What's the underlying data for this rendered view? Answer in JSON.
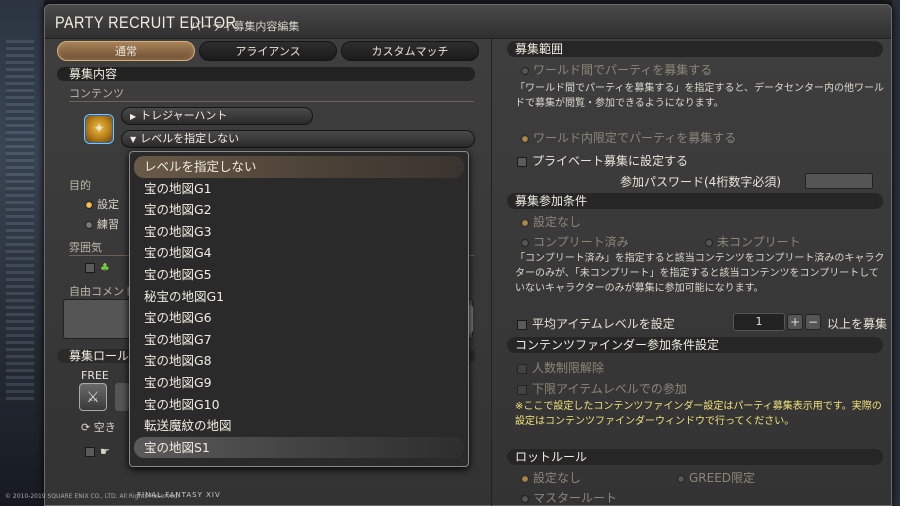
{
  "window": {
    "title": "PARTY RECRUIT EDITOR",
    "subtitle": "パーティ募集内容編集"
  },
  "tabs": [
    {
      "label": "通常",
      "active": true
    },
    {
      "label": "アライアンス",
      "active": false
    },
    {
      "label": "カスタムマッチ",
      "active": false
    }
  ],
  "left": {
    "recruit_header": "募集内容",
    "content_label": "コンテンツ",
    "category_value": "トレジャーハント",
    "level_value": "レベルを指定しない",
    "purpose_label": "目的",
    "purpose_opt1": "設定",
    "purpose_opt2": "練習",
    "atmosphere_label": "雰囲気",
    "comment_label": "自由コメント",
    "role_label": "募集ロール",
    "free_label": "FREE",
    "vacancy_label": "空き",
    "dropdown": {
      "items": [
        "レベルを指定しない",
        "宝の地図G1",
        "宝の地図G2",
        "宝の地図G3",
        "宝の地図G4",
        "宝の地図G5",
        "秘宝の地図G1",
        "宝の地図G6",
        "宝の地図G7",
        "宝の地図G8",
        "宝の地図G9",
        "宝の地図G10",
        "転送魔紋の地図",
        "宝の地図S1"
      ],
      "selected_index": 0,
      "hover_index": 13
    }
  },
  "right": {
    "range_header": "募集範囲",
    "world_between": "ワールド間でパーティを募集する",
    "world_between_note": "「ワールド間でパーティを募集する」を指定すると、データセンター内の他ワールドで募集が閲覧・参加できるようになります。",
    "world_within": "ワールド内限定でパーティを募集する",
    "private": "プライベート募集に設定する",
    "password_label": "参加パスワード(4桁数字必須)",
    "condition_header": "募集参加条件",
    "cond_none": "設定なし",
    "cond_complete": "コンプリート済み",
    "cond_incomplete": "未コンプリート",
    "cond_note": "「コンプリート済み」を指定すると該当コンテンツをコンプリート済みのキャラクターのみが、「未コンプリート」を指定すると該当コンテンツをコンプリートしていないキャラクターのみが募集に参加可能になります。",
    "avg_item_level": "平均アイテムレベルを設定",
    "avg_item_level_value": "1",
    "avg_item_level_suffix": "以上を募集",
    "finder_header": "コンテンツファインダー参加条件設定",
    "finder_unrestricted": "人数制限解除",
    "finder_min_ilvl": "下限アイテムレベルでの参加",
    "finder_note": "※ここで設定したコンテンツファインダー設定はパーティ募集表示用です。実際の設定はコンテンツファインダーウィンドウで行ってください。",
    "loot_header": "ロットルール",
    "loot_none": "設定なし",
    "loot_greed": "GREED限定",
    "loot_master": "マスタールート"
  },
  "footer": {
    "copyright": "© 2010-2019 SQUARE ENIX CO., LTD. All Rights Reserved.",
    "logo": "FINAL FANTASY XIV"
  }
}
